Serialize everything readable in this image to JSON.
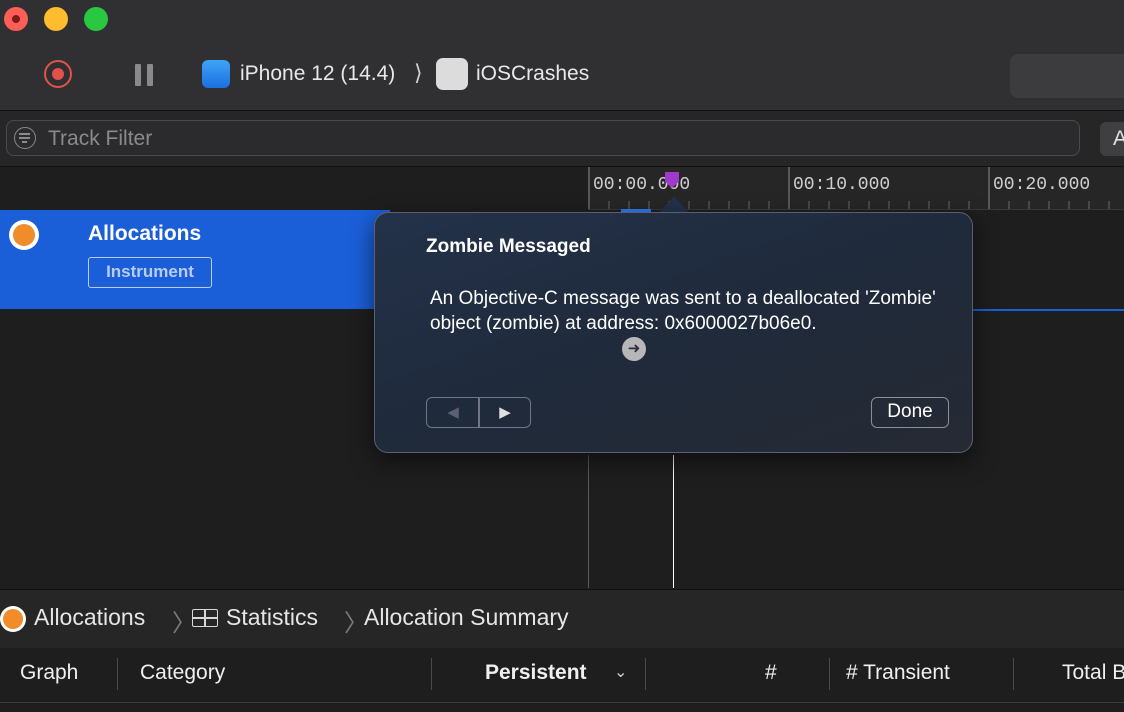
{
  "toolbar": {
    "device": "iPhone 12 (14.4)",
    "breadcrumb_separator": "⟩",
    "app": "iOSCrashes"
  },
  "filter": {
    "placeholder": "Track Filter",
    "right_button_label": "A"
  },
  "timeline": {
    "ticks": [
      "00:00.000",
      "00:10.000",
      "00:20.000"
    ]
  },
  "track": {
    "title": "Allocations",
    "badge": "Instrument"
  },
  "popover": {
    "title": "Zombie Messaged",
    "message": "An Objective-C message was sent to a deallocated 'Zombie' object (zombie) at address: 0x6000027b06e0.",
    "goto_glyph": "➜",
    "prev_glyph": "◀",
    "next_glyph": "▶",
    "done_label": "Done"
  },
  "breadcrumb": {
    "items": [
      "Allocations",
      "Statistics",
      "Allocation Summary"
    ],
    "separator": "〉"
  },
  "table": {
    "columns": [
      "Graph",
      "Category",
      "Persistent",
      "#",
      "# Transient",
      "Total B"
    ],
    "sort_indicator": "⌄"
  },
  "colors": {
    "selection_blue": "#1b5fd8",
    "playhead_purple": "#a13acb",
    "record_red": "#e2514a",
    "instrument_orange": "#f08c2a"
  }
}
